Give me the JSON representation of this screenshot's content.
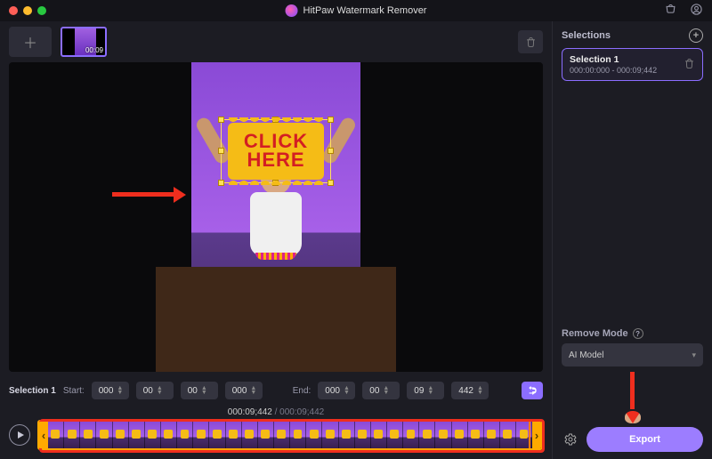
{
  "titlebar": {
    "app_name": "HitPaw Watermark Remover"
  },
  "media": {
    "clip_duration": "00:09"
  },
  "preview": {
    "sign_line1": "CLICK",
    "sign_line2": "HERE"
  },
  "controls": {
    "selection_label": "Selection 1",
    "start_label": "Start:",
    "end_label": "End:",
    "start": {
      "h": "000",
      "m": "00",
      "s": "00",
      "ms": "000"
    },
    "end": {
      "h": "000",
      "m": "00",
      "s": "09",
      "ms": "442"
    }
  },
  "timeline": {
    "current": "000:09;442",
    "total": "000:09;442"
  },
  "side": {
    "selections_label": "Selections",
    "items": [
      {
        "name": "Selection 1",
        "range": "000:00:000 - 000:09;442"
      }
    ],
    "remove_mode_label": "Remove Mode",
    "mode_value": "AI Model",
    "export_label": "Export"
  }
}
